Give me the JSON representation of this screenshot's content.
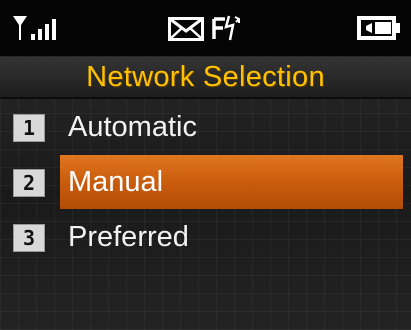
{
  "header": {
    "title": "Network Selection",
    "accent_color": "#ffc200",
    "icons": [
      "signal-strength-icon",
      "message-envelope-icon",
      "fax-icon",
      "battery-icon"
    ]
  },
  "menu": {
    "selected_index": 1,
    "highlight_color": "#d66a14",
    "items": [
      {
        "number": "1",
        "label": "Automatic"
      },
      {
        "number": "2",
        "label": "Manual"
      },
      {
        "number": "3",
        "label": "Preferred"
      }
    ]
  }
}
